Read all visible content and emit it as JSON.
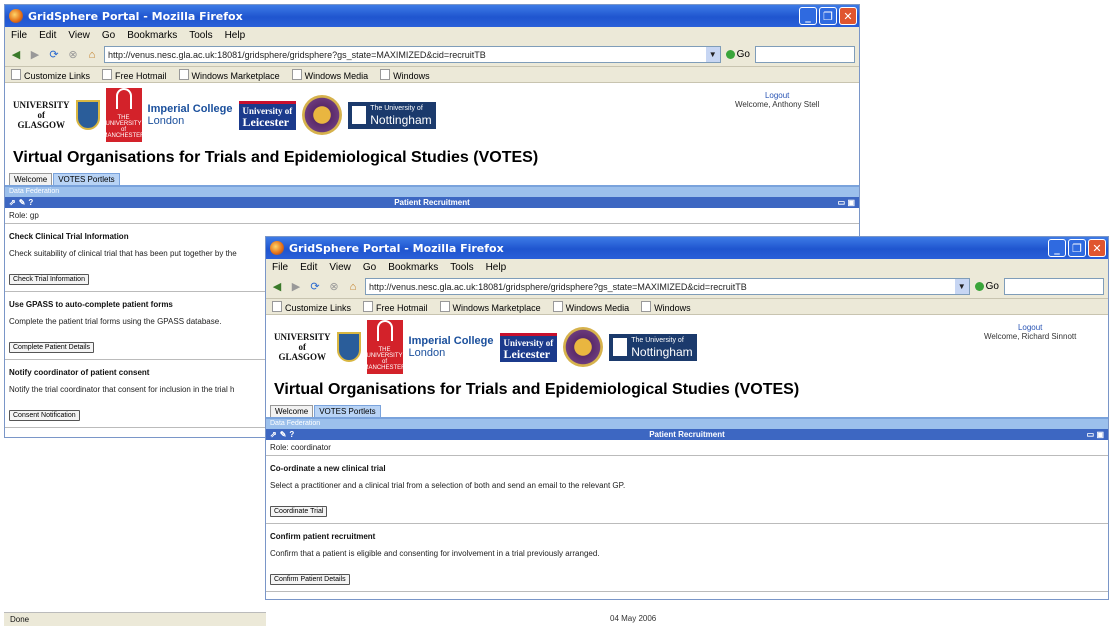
{
  "windowA": {
    "title": "GridSphere Portal - Mozilla Firefox",
    "menu": [
      "File",
      "Edit",
      "View",
      "Go",
      "Bookmarks",
      "Tools",
      "Help"
    ],
    "url": "http://venus.nesc.gla.ac.uk:18081/gridsphere/gridsphere?gs_state=MAXIMIZED&cid=recruitTB",
    "go_label": "Go",
    "links": [
      "Customize Links",
      "Free Hotmail",
      "Windows Marketplace",
      "Windows Media",
      "Windows"
    ],
    "logout_label": "Logout",
    "welcome": "Welcome, Anthony Stell",
    "site_title": "Virtual Organisations for Trials and Epidemiological Studies (VOTES)",
    "tabs": [
      "Welcome",
      "VOTES Portlets"
    ],
    "subbar": "Data Federation",
    "portlet_title": "Patient Recruitment",
    "role": "Role: gp",
    "sections": [
      {
        "heading": "Check Clinical Trial Information",
        "text": "Check suitability of clinical trial that has been put together by the",
        "button": "Check Trial Information"
      },
      {
        "heading": "Use GPASS to auto-complete patient forms",
        "text": "Complete the patient trial forms using the GPASS database.",
        "button": "Complete Patient Details"
      },
      {
        "heading": "Notify coordinator of patient consent",
        "text": "Notify the trial coordinator that consent for inclusion in the trial h",
        "button": "Consent Notification"
      }
    ]
  },
  "windowB": {
    "title": "GridSphere Portal - Mozilla Firefox",
    "menu": [
      "File",
      "Edit",
      "View",
      "Go",
      "Bookmarks",
      "Tools",
      "Help"
    ],
    "url": "http://venus.nesc.gla.ac.uk:18081/gridsphere/gridsphere?gs_state=MAXIMIZED&cid=recruitTB",
    "go_label": "Go",
    "links": [
      "Customize Links",
      "Free Hotmail",
      "Windows Marketplace",
      "Windows Media",
      "Windows"
    ],
    "logout_label": "Logout",
    "welcome": "Welcome, Richard Sinnott",
    "site_title": "Virtual Organisations for Trials and Epidemiological Studies (VOTES)",
    "tabs": [
      "Welcome",
      "VOTES Portlets"
    ],
    "subbar": "Data Federation",
    "portlet_title": "Patient Recruitment",
    "role": "Role: coordinator",
    "sections": [
      {
        "heading": "Co-ordinate a new clinical trial",
        "text": "Select a practitioner and a clinical trial from a selection of both and send an email to the relevant GP.",
        "button": "Coordinate Trial"
      },
      {
        "heading": "Confirm patient recruitment",
        "text": "Confirm that a patient is eligible and consenting for involvement in a trial previously arranged.",
        "button": "Confirm Patient Details"
      }
    ]
  },
  "logos": {
    "glasgow": [
      "UNIVERSITY",
      "of",
      "GLASGOW"
    ],
    "manchester": "THE UNIVERSITY of MANCHESTER",
    "imperial": [
      "Imperial College",
      "London"
    ],
    "leicester": [
      "University of",
      "Leicester"
    ],
    "nottingham": [
      "The University of",
      "Nottingham"
    ]
  },
  "status": "Done",
  "footer_date": "04 May 2006",
  "colors": {
    "titlebar": "#2a5fd8",
    "portlet_header": "#3d67c2",
    "tab_active": "#b8d3f5",
    "chrome": "#ece9d8"
  }
}
